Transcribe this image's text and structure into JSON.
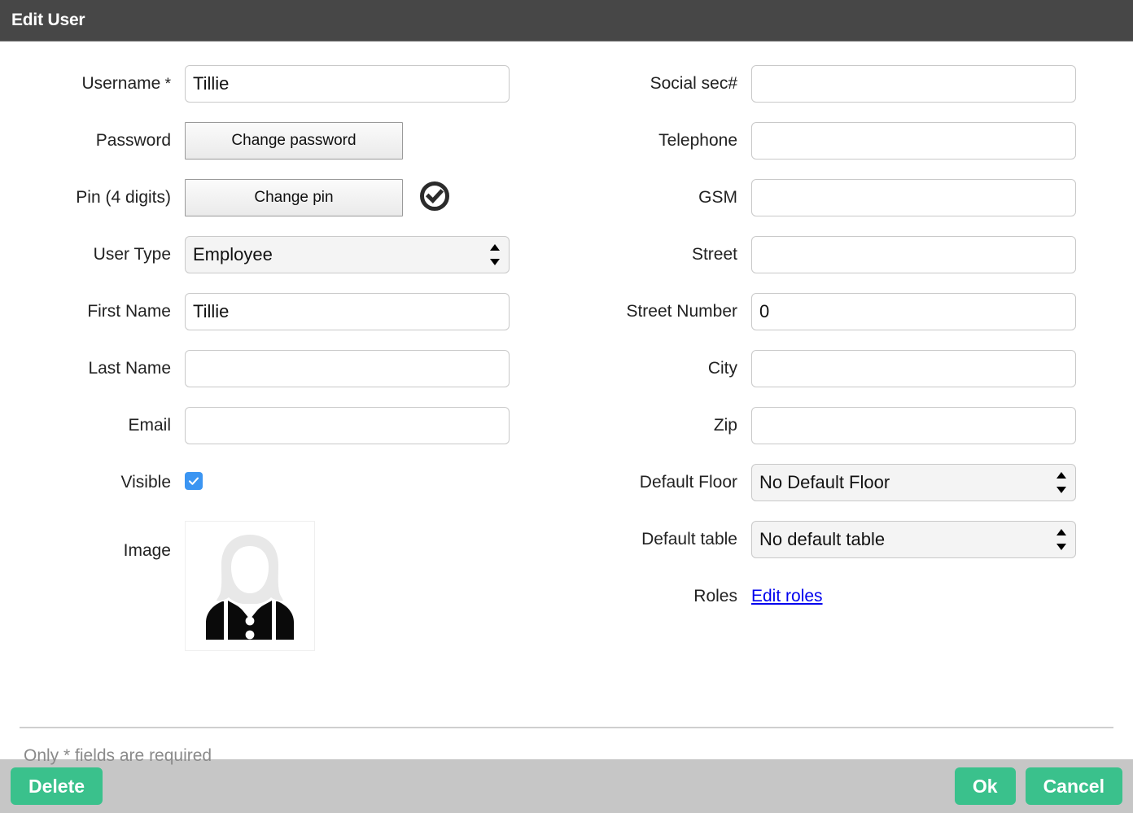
{
  "window": {
    "title": "Edit User"
  },
  "form": {
    "left": [
      {
        "label": "Username",
        "required_mark": " *",
        "type": "text",
        "value": "Tillie",
        "name": "username"
      },
      {
        "label": "Password",
        "type": "button",
        "value": "Change password",
        "name": "password"
      },
      {
        "label": "Pin (4 digits)",
        "type": "button-verified",
        "value": "Change pin",
        "name": "pin",
        "icon": "check-circle-icon"
      },
      {
        "label": "User Type",
        "type": "select",
        "value": "Employee",
        "name": "user-type"
      },
      {
        "label": "First Name",
        "type": "text",
        "value": "Tillie",
        "name": "first-name"
      },
      {
        "label": "Last Name",
        "type": "text",
        "value": "",
        "name": "last-name"
      },
      {
        "label": "Email",
        "type": "text",
        "value": "",
        "name": "email"
      },
      {
        "label": "Visible",
        "type": "checkbox",
        "checked": true,
        "name": "visible"
      },
      {
        "label": "Image",
        "type": "image",
        "name": "image",
        "icon": "user-avatar-placeholder-icon"
      }
    ],
    "right": [
      {
        "label": "Social sec#",
        "type": "text",
        "value": "",
        "name": "social-sec"
      },
      {
        "label": "Telephone",
        "type": "text",
        "value": "",
        "name": "telephone"
      },
      {
        "label": "GSM",
        "type": "text",
        "value": "",
        "name": "gsm"
      },
      {
        "label": "Street",
        "type": "text",
        "value": "",
        "name": "street"
      },
      {
        "label": "Street Number",
        "type": "text",
        "value": "0",
        "name": "street-number"
      },
      {
        "label": "City",
        "type": "text",
        "value": "",
        "name": "city"
      },
      {
        "label": "Zip",
        "type": "text",
        "value": "",
        "name": "zip"
      },
      {
        "label": "Default Floor",
        "type": "select",
        "value": "No Default Floor",
        "name": "default-floor"
      },
      {
        "label": "Default table",
        "type": "select",
        "value": "No default table",
        "name": "default-table"
      },
      {
        "label": "Roles",
        "type": "link",
        "value": "Edit roles",
        "name": "roles"
      }
    ]
  },
  "note": "Only * fields are required",
  "footer": {
    "delete_label": "Delete",
    "ok_label": "Ok",
    "cancel_label": "Cancel"
  },
  "colors": {
    "titlebar": "#474747",
    "accent_green": "#3ac18c",
    "checkbox_blue": "#3b95f2",
    "link_blue": "#0000ee",
    "footer_bar": "#c6c6c6"
  }
}
